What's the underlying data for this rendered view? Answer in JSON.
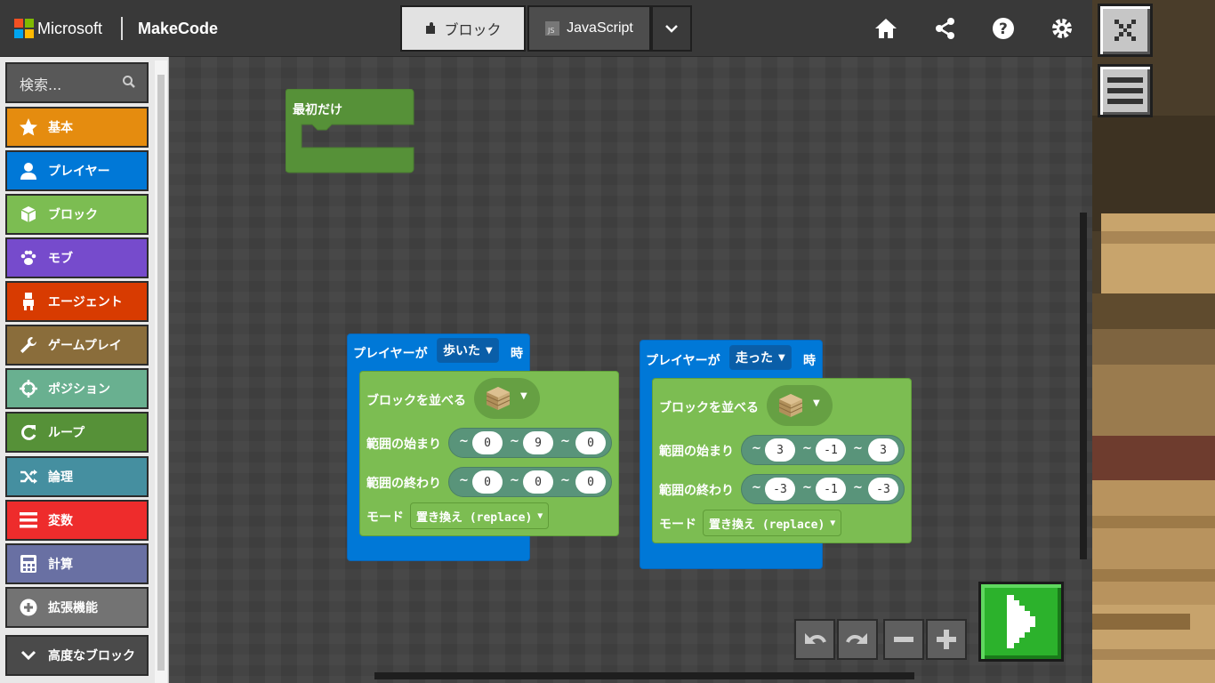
{
  "header": {
    "brand": "Microsoft",
    "product": "MakeCode",
    "tabs": {
      "blocks": "ブロック",
      "javascript": "JavaScript"
    },
    "icons": [
      "home-icon",
      "share-icon",
      "help-icon",
      "settings-icon"
    ]
  },
  "sidebar": {
    "search_placeholder": "検索...",
    "categories": [
      {
        "label": "基本",
        "icon": "star-icon",
        "color": "#e58c0f"
      },
      {
        "label": "プレイヤー",
        "icon": "person-icon",
        "color": "#0078d7"
      },
      {
        "label": "ブロック",
        "icon": "cube-icon",
        "color": "#7cbd52"
      },
      {
        "label": "モブ",
        "icon": "paw-icon",
        "color": "#764bcc"
      },
      {
        "label": "エージェント",
        "icon": "agent-icon",
        "color": "#d83b01"
      },
      {
        "label": "ゲームプレイ",
        "icon": "wrench-icon",
        "color": "#8a6d3b"
      },
      {
        "label": "ポジション",
        "icon": "crosshair-icon",
        "color": "#69b090"
      },
      {
        "label": "ループ",
        "icon": "loop-icon",
        "color": "#569138"
      },
      {
        "label": "論理",
        "icon": "shuffle-icon",
        "color": "#458fa0"
      },
      {
        "label": "変数",
        "icon": "list-icon",
        "color": "#ee2c2c"
      },
      {
        "label": "計算",
        "icon": "calculator-icon",
        "color": "#6970a3"
      },
      {
        "label": "拡張機能",
        "icon": "plus-circle-icon",
        "color": "#737373"
      }
    ],
    "advanced": "高度なブロック"
  },
  "workspace": {
    "on_start": {
      "label": "最初だけ"
    },
    "event_blocks": [
      {
        "player_label": "プレイヤーが",
        "action": "歩いた",
        "when_label": "時",
        "fill_label": "ブロックを並べる",
        "from_label": "範囲の始まり",
        "from": [
          "0",
          "9",
          "0"
        ],
        "to_label": "範囲の終わり",
        "to": [
          "0",
          "0",
          "0"
        ],
        "mode_label": "モード",
        "mode": "置き換え (replace)"
      },
      {
        "player_label": "プレイヤーが",
        "action": "走った",
        "when_label": "時",
        "fill_label": "ブロックを並べる",
        "from_label": "範囲の始まり",
        "from": [
          "3",
          "-1",
          "3"
        ],
        "to_label": "範囲の終わり",
        "to": [
          "-3",
          "-1",
          "-3"
        ],
        "mode_label": "モード",
        "mode": "置き換え (replace)"
      }
    ],
    "tilde": "~",
    "controls": [
      "undo-icon",
      "redo-icon",
      "zoom-out-icon",
      "zoom-in-icon",
      "run-icon"
    ]
  },
  "colors": {
    "player_event": "#0078d7",
    "blocks": "#7cbd52",
    "position": "#59947a",
    "run_button": "#2cb22c"
  }
}
